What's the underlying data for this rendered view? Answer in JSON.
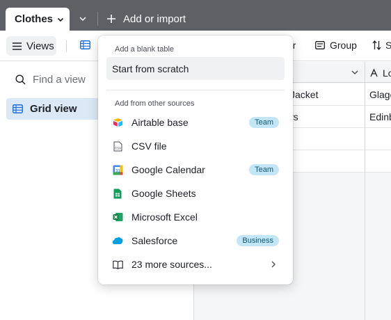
{
  "tabs": {
    "active": "Clothes",
    "add_import": "Add or import"
  },
  "toolbar": {
    "views": "Views",
    "filter_tail": "er",
    "group": "Group",
    "sort_tail": "S"
  },
  "sidebar": {
    "search_placeholder": "Find a view",
    "active_view": "Grid view"
  },
  "grid": {
    "header_col2": "Lo",
    "rows": [
      {
        "col1": "Jacket",
        "col2": "Glago"
      },
      {
        "col1": "rs",
        "col2": "Edinb"
      },
      {
        "col1": "",
        "col2": ""
      },
      {
        "col1": "",
        "col2": ""
      }
    ]
  },
  "dropdown": {
    "blank_heading": "Add a blank table",
    "scratch": "Start from scratch",
    "sources_heading": "Add from other sources",
    "items": [
      {
        "label": "Airtable base",
        "badge": "Team",
        "icon": "airtable-icon"
      },
      {
        "label": "CSV file",
        "badge": "",
        "icon": "csv-file-icon"
      },
      {
        "label": "Google Calendar",
        "badge": "Team",
        "icon": "google-calendar-icon"
      },
      {
        "label": "Google Sheets",
        "badge": "",
        "icon": "google-sheets-icon"
      },
      {
        "label": "Microsoft Excel",
        "badge": "",
        "icon": "excel-icon"
      },
      {
        "label": "Salesforce",
        "badge": "Business",
        "icon": "salesforce-icon"
      },
      {
        "label": "23 more sources...",
        "badge": "",
        "icon": "book-icon"
      }
    ]
  },
  "colors": {
    "topbar": "#5e6066",
    "selected_view": "#dbe9f7",
    "badge_bg": "#c3e6f6",
    "badge_text": "#0e5776"
  }
}
